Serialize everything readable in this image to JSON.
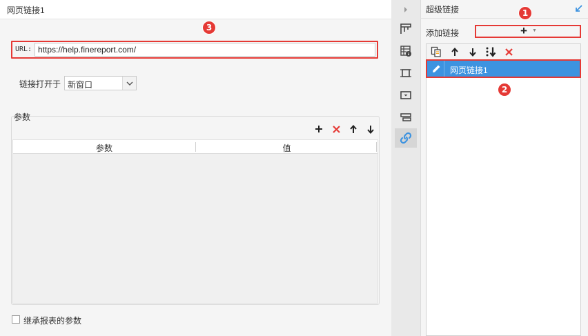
{
  "left_panel": {
    "title": "网页链接1",
    "url": {
      "label": "URL:",
      "value": "https://help.finereport.com/"
    },
    "open_in": {
      "label": "链接打开于",
      "selected": "新窗口"
    },
    "params": {
      "section_label": "参数",
      "toolbar": [
        "add-icon",
        "delete-icon",
        "move-up-icon",
        "move-down-icon"
      ],
      "columns": [
        "参数",
        "值"
      ],
      "rows": []
    },
    "inherit": {
      "label": "继承报表的参数",
      "checked": false
    }
  },
  "icon_strip": {
    "items": [
      "collapse-arrow-icon",
      "cell-attribute-icon",
      "cell-element-icon",
      "cell-border-icon",
      "widget-icon",
      "condition-attribute-icon",
      "hyperlink-icon"
    ],
    "active": "hyperlink-icon"
  },
  "right_panel": {
    "title": "超级链接",
    "add_label": "添加链接",
    "list_toolbar": [
      "copy-icon",
      "move-up-icon",
      "move-down-icon",
      "sort-icon",
      "delete-icon"
    ],
    "items": [
      {
        "label": "网页链接1",
        "selected": true
      }
    ]
  },
  "callouts": [
    "1",
    "2",
    "3"
  ],
  "colors": {
    "highlight": "#e53935",
    "selection": "#3d93e0",
    "delete": "#e53935",
    "link_icon": "#3d93e0"
  }
}
